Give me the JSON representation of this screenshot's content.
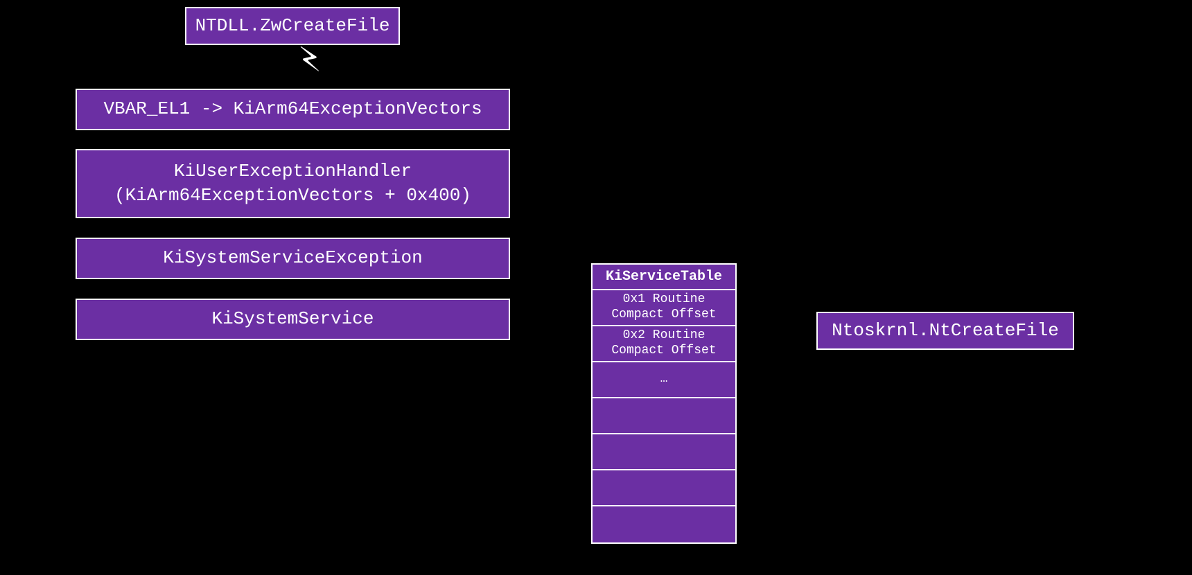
{
  "boxes": {
    "ntdll": "NTDLL.ZwCreateFile",
    "vbar": "VBAR_EL1 -> KiArm64ExceptionVectors",
    "kiuser_line1": "KiUserExceptionHandler",
    "kiuser_line2": "(KiArm64ExceptionVectors + 0x400)",
    "kisse": "KiSystemServiceException",
    "kiss": "KiSystemService",
    "ntoskrnl": "Ntoskrnl.NtCreateFile"
  },
  "table": {
    "header": "KiServiceTable",
    "rows": [
      "0x1 Routine\nCompact Offset",
      "0x2 Routine\nCompact Offset",
      "…",
      "",
      "",
      "",
      ""
    ]
  },
  "icon": {
    "bolt": "⚡"
  }
}
